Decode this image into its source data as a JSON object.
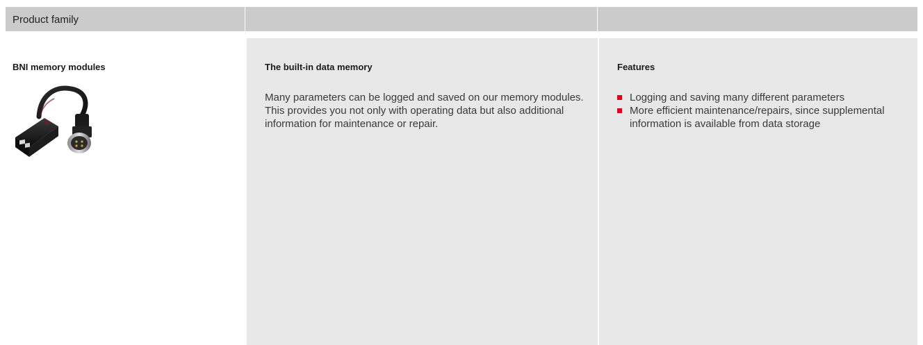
{
  "header": {
    "col1_label": "Product family",
    "col2_label": "",
    "col3_label": ""
  },
  "product": {
    "name": "BNI memory modules",
    "image_icon": "memory-module-connector-image"
  },
  "description": {
    "title": "The built-in data memory",
    "text": "Many parameters can be logged and saved on our memory modules. This provides you not only with operating data but also additional information for maintenance or repair."
  },
  "features": {
    "title": "Features",
    "items": [
      "Logging and saving many different parameters",
      "More efficient maintenance/repairs, since supplemental information is available from data storage"
    ]
  },
  "colors": {
    "header_bg": "#cbcbcb",
    "column_bg": "#e8e8e8",
    "bullet": "#e2001a"
  }
}
